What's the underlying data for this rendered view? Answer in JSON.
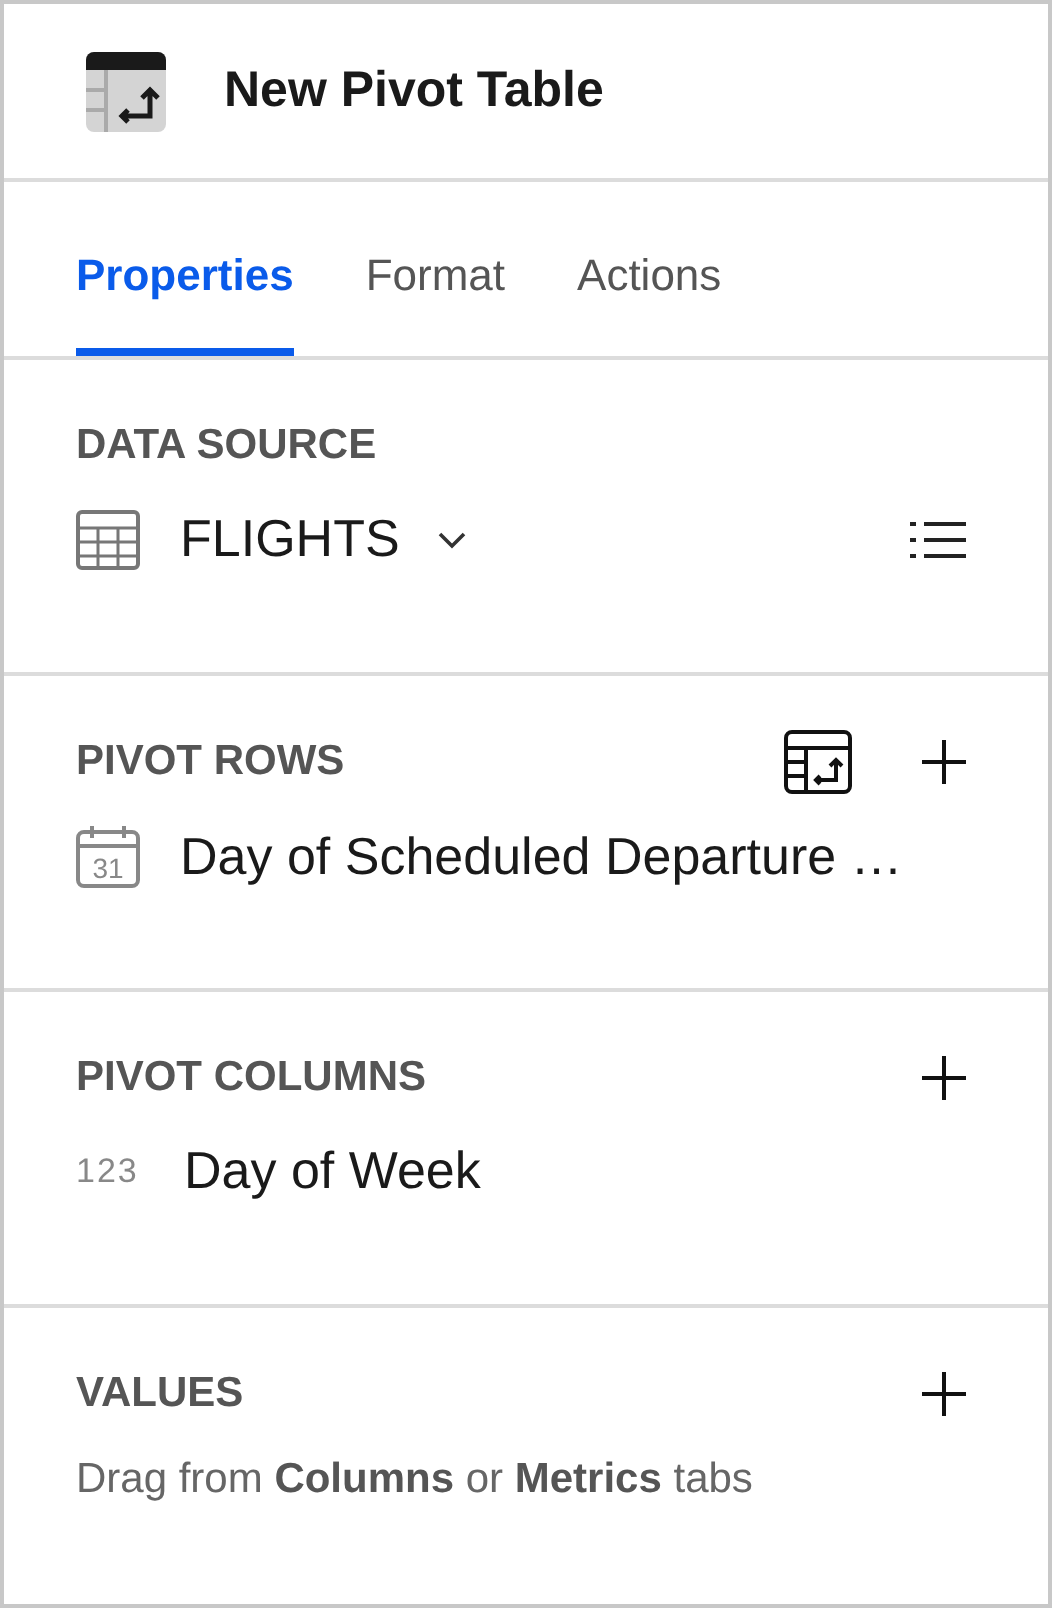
{
  "header": {
    "title": "New Pivot Table"
  },
  "tabs": [
    {
      "label": "Properties",
      "selected": true
    },
    {
      "label": "Format",
      "selected": false
    },
    {
      "label": "Actions",
      "selected": false
    }
  ],
  "data_source": {
    "heading": "DATA SOURCE",
    "name": "FLIGHTS"
  },
  "sections": [
    {
      "heading": "PIVOT ROWS",
      "actions": [
        {
          "kind": "pivot"
        },
        {
          "kind": "add"
        }
      ],
      "fields": [
        {
          "kind": "date",
          "icon_text": "31",
          "label": "Day of Scheduled Departure …"
        }
      ]
    },
    {
      "heading": "PIVOT COLUMNS",
      "actions": [
        {
          "kind": "add"
        }
      ],
      "fields": [
        {
          "kind": "number",
          "icon_text": "123",
          "label": "Day of Week"
        }
      ]
    },
    {
      "heading": "VALUES",
      "actions": [
        {
          "kind": "add"
        }
      ],
      "hint": "Drag from **Columns** or **Metrics** tabs"
    }
  ]
}
